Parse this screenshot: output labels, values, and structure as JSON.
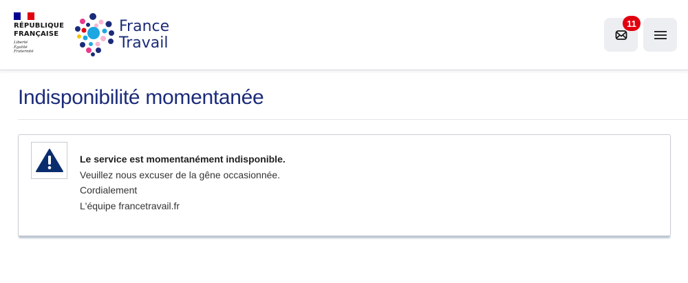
{
  "header": {
    "republique": {
      "name_line1": "RÉPUBLIQUE",
      "name_line2": "FRANÇAISE",
      "motto": [
        "Liberté",
        "Égalité",
        "Fraternité"
      ],
      "flag_colors": [
        "#000091",
        "#ffffff",
        "#e1000f"
      ]
    },
    "brand": {
      "line1": "France",
      "line2": "Travail",
      "color": "#1b2b7a"
    },
    "messages": {
      "icon": "envelope-icon",
      "badge_count": "11",
      "badge_color": "#e1000f"
    },
    "menu": {
      "icon": "hamburger-menu-icon"
    }
  },
  "main": {
    "title": "Indisponibilité momentanée",
    "alert": {
      "icon": "warning-triangle-icon",
      "icon_color": "#0a2d6e",
      "heading": "Le service est momentanément indisponible.",
      "lines": [
        "Veuillez nous excuser de la gêne occasionnée.",
        "Cordialement",
        "L'équipe francetravail.fr"
      ]
    }
  }
}
